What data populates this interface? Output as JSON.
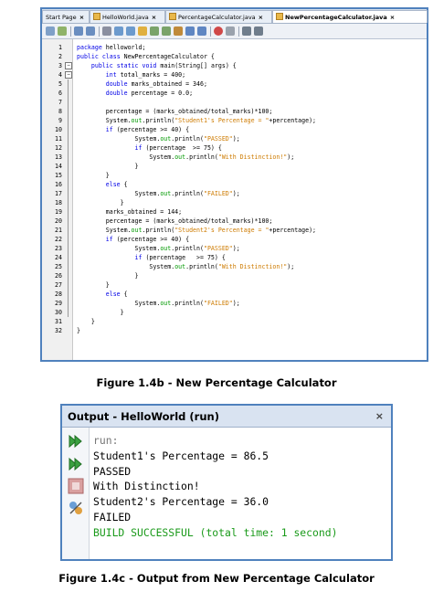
{
  "editor": {
    "tabs": [
      {
        "label": "Start Page",
        "active": false
      },
      {
        "label": "HelloWorld.java",
        "active": false
      },
      {
        "label": "PercentageCalculator.java",
        "active": false
      },
      {
        "label": "NewPercentageCalculator.java",
        "active": true
      }
    ],
    "tab_close": "×",
    "fold_minus": "−",
    "toolbar_icons": [
      "source-view-icon",
      "history-icon",
      "back-icon",
      "forward-icon",
      "find-icon",
      "find-prev-icon",
      "find-next-icon",
      "toggle-highlight-icon",
      "prev-bookmark-icon",
      "next-bookmark-icon",
      "toggle-bookmark-icon",
      "shift-left-icon",
      "shift-right-icon",
      "start-macro-icon",
      "stop-macro-icon",
      "comment-icon",
      "uncomment-icon"
    ],
    "line_numbers": [
      "1",
      "2",
      "3",
      "4",
      "5",
      "6",
      "7",
      "8",
      "9",
      "10",
      "11",
      "12",
      "13",
      "14",
      "15",
      "16",
      "17",
      "18",
      "19",
      "20",
      "21",
      "22",
      "23",
      "24",
      "25",
      "26",
      "27",
      "28",
      "29",
      "30",
      "31",
      "32"
    ],
    "code": [
      [
        {
          "t": "package helloworld;",
          "c": "plain"
        }
      ],
      [
        {
          "t": "public class NewPercentageCalculator {",
          "c": "plain"
        }
      ],
      [
        {
          "t": "    public static void main(String[] args) {",
          "c": "plain"
        }
      ],
      [
        {
          "t": "        int total_marks = 400;",
          "c": "plain"
        }
      ],
      [
        {
          "t": "        double marks_obtained = 346;",
          "c": "plain"
        }
      ],
      [
        {
          "t": "        double percentage = 0.0;",
          "c": "plain"
        }
      ],
      [],
      [
        {
          "t": "        percentage = (marks_obtained/total_marks)*100;",
          "c": "plain"
        }
      ],
      [
        {
          "t": "        System.",
          "c": "plain"
        },
        {
          "t": "out",
          "c": "fld"
        },
        {
          "t": ".println(",
          "c": "plain"
        },
        {
          "t": "\"Student1's Percentage = \"",
          "c": "str"
        },
        {
          "t": "+percentage);",
          "c": "plain"
        }
      ],
      [
        {
          "t": "        if (percentage >= 40) {",
          "c": "plain"
        }
      ],
      [
        {
          "t": "                System.",
          "c": "plain"
        },
        {
          "t": "out",
          "c": "fld"
        },
        {
          "t": ".println(",
          "c": "plain"
        },
        {
          "t": "\"PASSED\"",
          "c": "str"
        },
        {
          "t": ");",
          "c": "plain"
        }
      ],
      [
        {
          "t": "                if (percentage  >= 75) {",
          "c": "plain"
        }
      ],
      [
        {
          "t": "                    System.",
          "c": "plain"
        },
        {
          "t": "out",
          "c": "fld"
        },
        {
          "t": ".println(",
          "c": "plain"
        },
        {
          "t": "\"With Distinction!\"",
          "c": "str"
        },
        {
          "t": ");",
          "c": "plain"
        }
      ],
      [
        {
          "t": "                }",
          "c": "plain"
        }
      ],
      [
        {
          "t": "        }",
          "c": "plain"
        }
      ],
      [
        {
          "t": "        else {",
          "c": "plain"
        }
      ],
      [
        {
          "t": "                System.",
          "c": "plain"
        },
        {
          "t": "out",
          "c": "fld"
        },
        {
          "t": ".println(",
          "c": "plain"
        },
        {
          "t": "\"FAILED\"",
          "c": "str"
        },
        {
          "t": ");",
          "c": "plain"
        }
      ],
      [
        {
          "t": "            }",
          "c": "plain"
        }
      ],
      [
        {
          "t": "        marks_obtained = 144;",
          "c": "plain"
        }
      ],
      [
        {
          "t": "        percentage = (marks_obtained/total_marks)*100;",
          "c": "plain"
        }
      ],
      [
        {
          "t": "        System.",
          "c": "plain"
        },
        {
          "t": "out",
          "c": "fld"
        },
        {
          "t": ".println(",
          "c": "plain"
        },
        {
          "t": "\"Student2's Percentage = \"",
          "c": "str"
        },
        {
          "t": "+percentage);",
          "c": "plain"
        }
      ],
      [
        {
          "t": "        if (percentage >= 40) {",
          "c": "plain"
        }
      ],
      [
        {
          "t": "                System.",
          "c": "plain"
        },
        {
          "t": "out",
          "c": "fld"
        },
        {
          "t": ".println(",
          "c": "plain"
        },
        {
          "t": "\"PASSED\"",
          "c": "str"
        },
        {
          "t": ");",
          "c": "plain"
        }
      ],
      [
        {
          "t": "                if (percentage   >= 75) {",
          "c": "plain"
        }
      ],
      [
        {
          "t": "                    System.",
          "c": "plain"
        },
        {
          "t": "out",
          "c": "fld"
        },
        {
          "t": ".println(",
          "c": "plain"
        },
        {
          "t": "\"With Distinction!\"",
          "c": "str"
        },
        {
          "t": ");",
          "c": "plain"
        }
      ],
      [
        {
          "t": "                }",
          "c": "plain"
        }
      ],
      [
        {
          "t": "        }",
          "c": "plain"
        }
      ],
      [
        {
          "t": "        else {",
          "c": "plain"
        }
      ],
      [
        {
          "t": "                System.",
          "c": "plain"
        },
        {
          "t": "out",
          "c": "fld"
        },
        {
          "t": ".println(",
          "c": "plain"
        },
        {
          "t": "\"FAILED\"",
          "c": "str"
        },
        {
          "t": ");",
          "c": "plain"
        }
      ],
      [
        {
          "t": "            }",
          "c": "plain"
        }
      ],
      [
        {
          "t": "    }",
          "c": "plain"
        }
      ],
      [
        {
          "t": "}",
          "c": "plain"
        }
      ]
    ]
  },
  "caption_editor": "Figure 1.4b - New Percentage Calculator",
  "output": {
    "title": "Output - HelloWorld (run)",
    "close": "×",
    "side_icons": [
      "rerun-icon",
      "rerun-with-params-icon",
      "stop-icon",
      "settings-icon"
    ],
    "lines": [
      {
        "text": "run:",
        "style": "gray"
      },
      {
        "text": "Student1's Percentage = 86.5",
        "style": "normal"
      },
      {
        "text": "PASSED",
        "style": "normal"
      },
      {
        "text": "With Distinction!",
        "style": "normal"
      },
      {
        "text": "Student2's Percentage = 36.0",
        "style": "normal"
      },
      {
        "text": "FAILED",
        "style": "normal"
      },
      {
        "text": "BUILD SUCCESSFUL (total time: 1 second)",
        "style": "green"
      }
    ]
  },
  "caption_output": "Figure 1.4c - Output from New Percentage Calculator",
  "colors": {
    "frame": "#4f81bd",
    "keyword": "#0000e6",
    "string": "#ce7b00",
    "field": "#009900",
    "build_success": "#1a9a1a"
  }
}
